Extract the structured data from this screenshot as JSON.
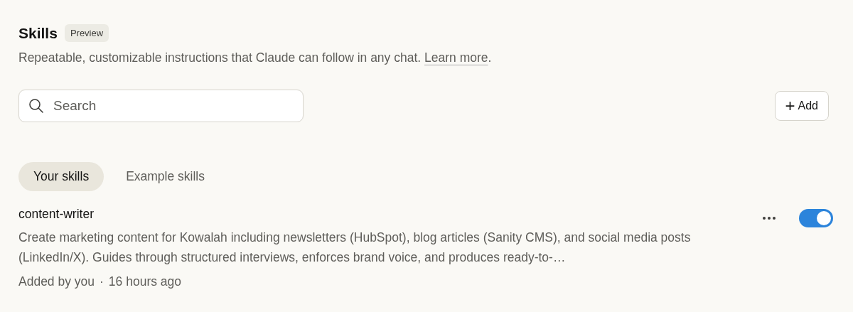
{
  "header": {
    "title": "Skills",
    "badge": "Preview",
    "description": "Repeatable, customizable instructions that Claude can follow in any chat.",
    "link": "Learn more",
    "link_end": "."
  },
  "search": {
    "placeholder": "Search"
  },
  "add_button": {
    "icon": "+",
    "label": "Add"
  },
  "tabs": [
    {
      "label": "Your skills",
      "selected": true
    },
    {
      "label": "Example skills",
      "selected": false
    }
  ],
  "skills": [
    {
      "name": "content-writer",
      "description": "Create marketing content for Kowalah including newsletters (HubSpot), blog articles (Sanity CMS), and social media posts (LinkedIn/X). Guides through structured interviews, enforces brand voice, and produces ready-to-…",
      "added_by": "Added by you",
      "separator": "·",
      "time": "16 hours ago",
      "on": true
    }
  ]
}
